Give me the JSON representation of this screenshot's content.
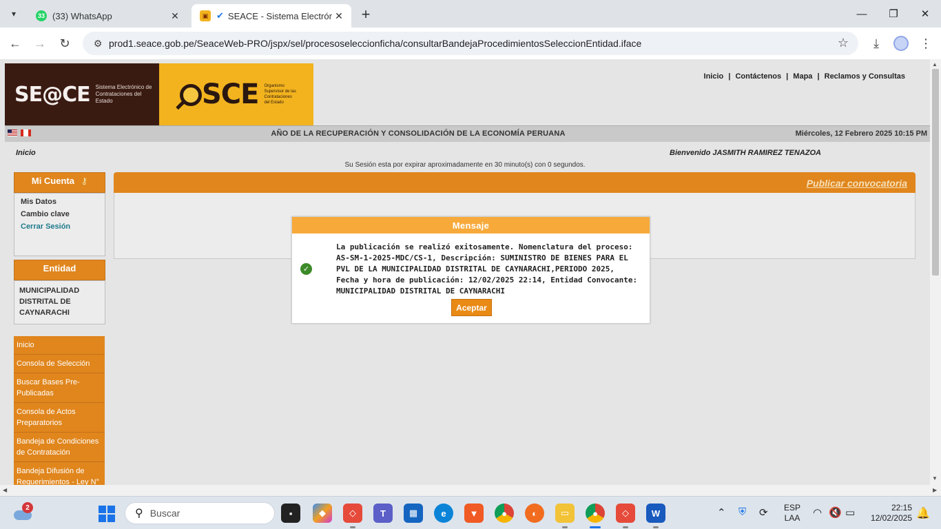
{
  "browser": {
    "tabs": [
      {
        "label": "(33) WhatsApp",
        "badge": "33",
        "active": false
      },
      {
        "label": "SEACE - Sistema Electrónico",
        "badge": "OSCE",
        "active": true
      }
    ],
    "url": "prod1.seace.gob.pe/SeaceWeb-PRO/jspx/sel/procesoseleccionficha/consultarBandejaProcedimientosSeleccionEntidad.iface"
  },
  "header": {
    "seace_logo_text": "SE@CE",
    "seace_subtitle": "Sistema Electrónico de Contrataciones del Estado",
    "osce_logo_text": "SCE",
    "osce_subtitle": "Organismo Supervisor de las Contrataciones del Estado",
    "nav": {
      "inicio": "Inicio",
      "contactenos": "Contáctenos",
      "mapa": "Mapa",
      "reclamos": "Reclamos y Consultas",
      "sep": "|"
    }
  },
  "strip": {
    "year_title": "AÑO DE LA RECUPERACIÓN Y CONSOLIDACIÓN DE LA ECONOMÍA PERUANA",
    "datetime": "Miércoles, 12 Febrero 2025 10:15 PM"
  },
  "breadcrumb": "Inicio",
  "welcome": "Bienvenido  JASMITH RAMIREZ TENAZOA",
  "session_text": "Su Sesión esta por expirar aproximadamente en 30 minuto(s) con 0 segundos.",
  "account": {
    "title": "Mi Cuenta",
    "links": [
      "Mis Datos",
      "Cambio clave",
      "Cerrar Sesión"
    ]
  },
  "entidad": {
    "title": "Entidad",
    "name": "MUNICIPALIDAD DISTRITAL DE CAYNARACHI"
  },
  "side_menu": [
    "Inicio",
    "Consola de Selección",
    "Buscar Bases Pre-Publicadas",
    "Consola de Actos Preparatorios",
    "Bandeja de Condiciones de Contratación",
    "Bandeja Difusión de Requerimientos - Ley N°"
  ],
  "main": {
    "publicar_link": "Publicar convocatoria"
  },
  "modal": {
    "title": "Mensaje",
    "message": "La publicación se realizó exitosamente. Nomenclatura del proceso: AS-SM-1-2025-MDC/CS-1, Descripción: SUMINISTRO DE BIENES PARA EL PVL DE LA MUNICIPALIDAD DISTRITAL DE CAYNARACHI,PERIODO 2025, Fecha y hora de publicación: 12/02/2025 22:14, Entidad Convocante: MUNICIPALIDAD DISTRITAL DE CAYNARACHI",
    "accept_label": "Aceptar"
  },
  "taskbar": {
    "weather_badge": "2",
    "search_placeholder": "Buscar",
    "lang": "ESP",
    "layout": "LAA",
    "time": "22:15",
    "date": "12/02/2025"
  },
  "colors": {
    "orange": "#e0861d",
    "modal_header": "#f7a93a",
    "success": "#3d8a2a"
  }
}
